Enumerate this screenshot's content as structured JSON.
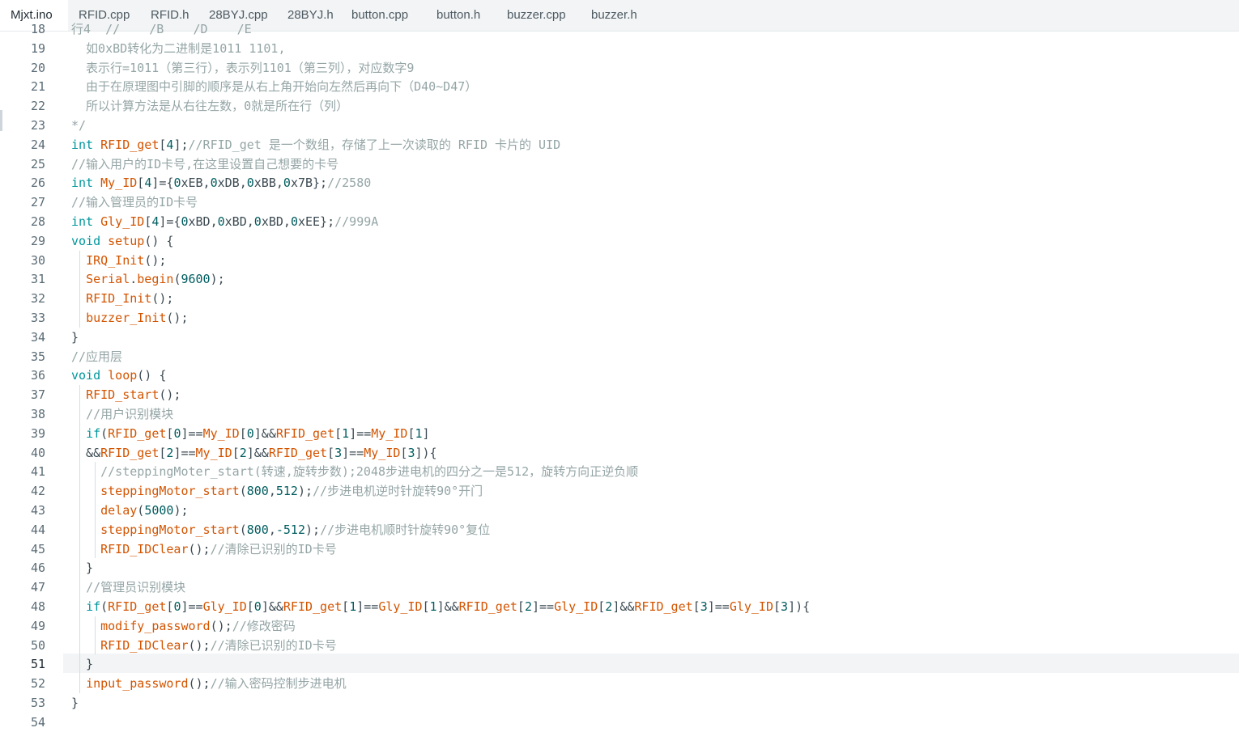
{
  "tabs": [
    {
      "label": "Mjxt.ino",
      "active": true
    },
    {
      "label": "RFID.cpp",
      "active": false
    },
    {
      "label": "RFID.h",
      "active": false
    },
    {
      "label": "28BYJ.cpp",
      "active": false
    },
    {
      "label": "28BYJ.h",
      "active": false
    },
    {
      "label": "button.cpp",
      "active": false
    },
    {
      "label": "button.h",
      "active": false
    },
    {
      "label": "buzzer.cpp",
      "active": false
    },
    {
      "label": "buzzer.h",
      "active": false
    }
  ],
  "editor": {
    "current_line": "51",
    "lines": [
      {
        "num": "18",
        "text": "行4  //    /B    /D    /E"
      },
      {
        "num": "19",
        "text": "  如0xBD转化为二进制是1011 1101,"
      },
      {
        "num": "20",
        "text": "  表示行=1011（第三行），表示列1101（第三列），对应数字9"
      },
      {
        "num": "21",
        "text": "  由于在原理图中引脚的顺序是从右上角开始向左然后再向下（D40~D47）"
      },
      {
        "num": "22",
        "text": "  所以计算方法是从右往左数，0就是所在行（列）"
      },
      {
        "num": "23",
        "text": "*/"
      },
      {
        "num": "24",
        "text": "int RFID_get[4];//RFID_get 是一个数组，存储了上一次读取的 RFID 卡片的 UID"
      },
      {
        "num": "25",
        "text": "//输入用户的ID卡号,在这里设置自己想要的卡号"
      },
      {
        "num": "26",
        "text": "int My_ID[4]={0xEB,0xDB,0xBB,0x7B};//2580"
      },
      {
        "num": "27",
        "text": "//输入管理员的ID卡号"
      },
      {
        "num": "28",
        "text": "int Gly_ID[4]={0xBD,0xBD,0xBD,0xEE};//999A"
      },
      {
        "num": "29",
        "text": "void setup() {"
      },
      {
        "num": "30",
        "text": "  IRQ_Init();"
      },
      {
        "num": "31",
        "text": "  Serial.begin(9600);"
      },
      {
        "num": "32",
        "text": "  RFID_Init();"
      },
      {
        "num": "33",
        "text": "  buzzer_Init();"
      },
      {
        "num": "34",
        "text": "}"
      },
      {
        "num": "35",
        "text": "//应用层"
      },
      {
        "num": "36",
        "text": "void loop() {"
      },
      {
        "num": "37",
        "text": "  RFID_start();"
      },
      {
        "num": "38",
        "text": "  //用户识别模块"
      },
      {
        "num": "39",
        "text": "  if(RFID_get[0]==My_ID[0]&&RFID_get[1]==My_ID[1]"
      },
      {
        "num": "40",
        "text": "  &&RFID_get[2]==My_ID[2]&&RFID_get[3]==My_ID[3]){"
      },
      {
        "num": "41",
        "text": "    //steppingMoter_start(转速,旋转步数);2048步进电机的四分之一是512，旋转方向正逆负顺"
      },
      {
        "num": "42",
        "text": "    steppingMotor_start(800,512);//步进电机逆时针旋转90°开门"
      },
      {
        "num": "43",
        "text": "    delay(5000);"
      },
      {
        "num": "44",
        "text": "    steppingMotor_start(800,-512);//步进电机顺时针旋转90°复位"
      },
      {
        "num": "45",
        "text": "    RFID_IDClear();//清除已识别的ID卡号"
      },
      {
        "num": "46",
        "text": "  }"
      },
      {
        "num": "47",
        "text": "  //管理员识别模块"
      },
      {
        "num": "48",
        "text": "  if(RFID_get[0]==Gly_ID[0]&&RFID_get[1]==Gly_ID[1]&&RFID_get[2]==Gly_ID[2]&&RFID_get[3]==Gly_ID[3]){"
      },
      {
        "num": "49",
        "text": "    modify_password();//修改密码"
      },
      {
        "num": "50",
        "text": "    RFID_IDClear();//清除已识别的ID卡号"
      },
      {
        "num": "51",
        "text": "  }"
      },
      {
        "num": "52",
        "text": "  input_password();//输入密码控制步进电机"
      },
      {
        "num": "53",
        "text": "}"
      },
      {
        "num": "54",
        "text": ""
      }
    ]
  }
}
